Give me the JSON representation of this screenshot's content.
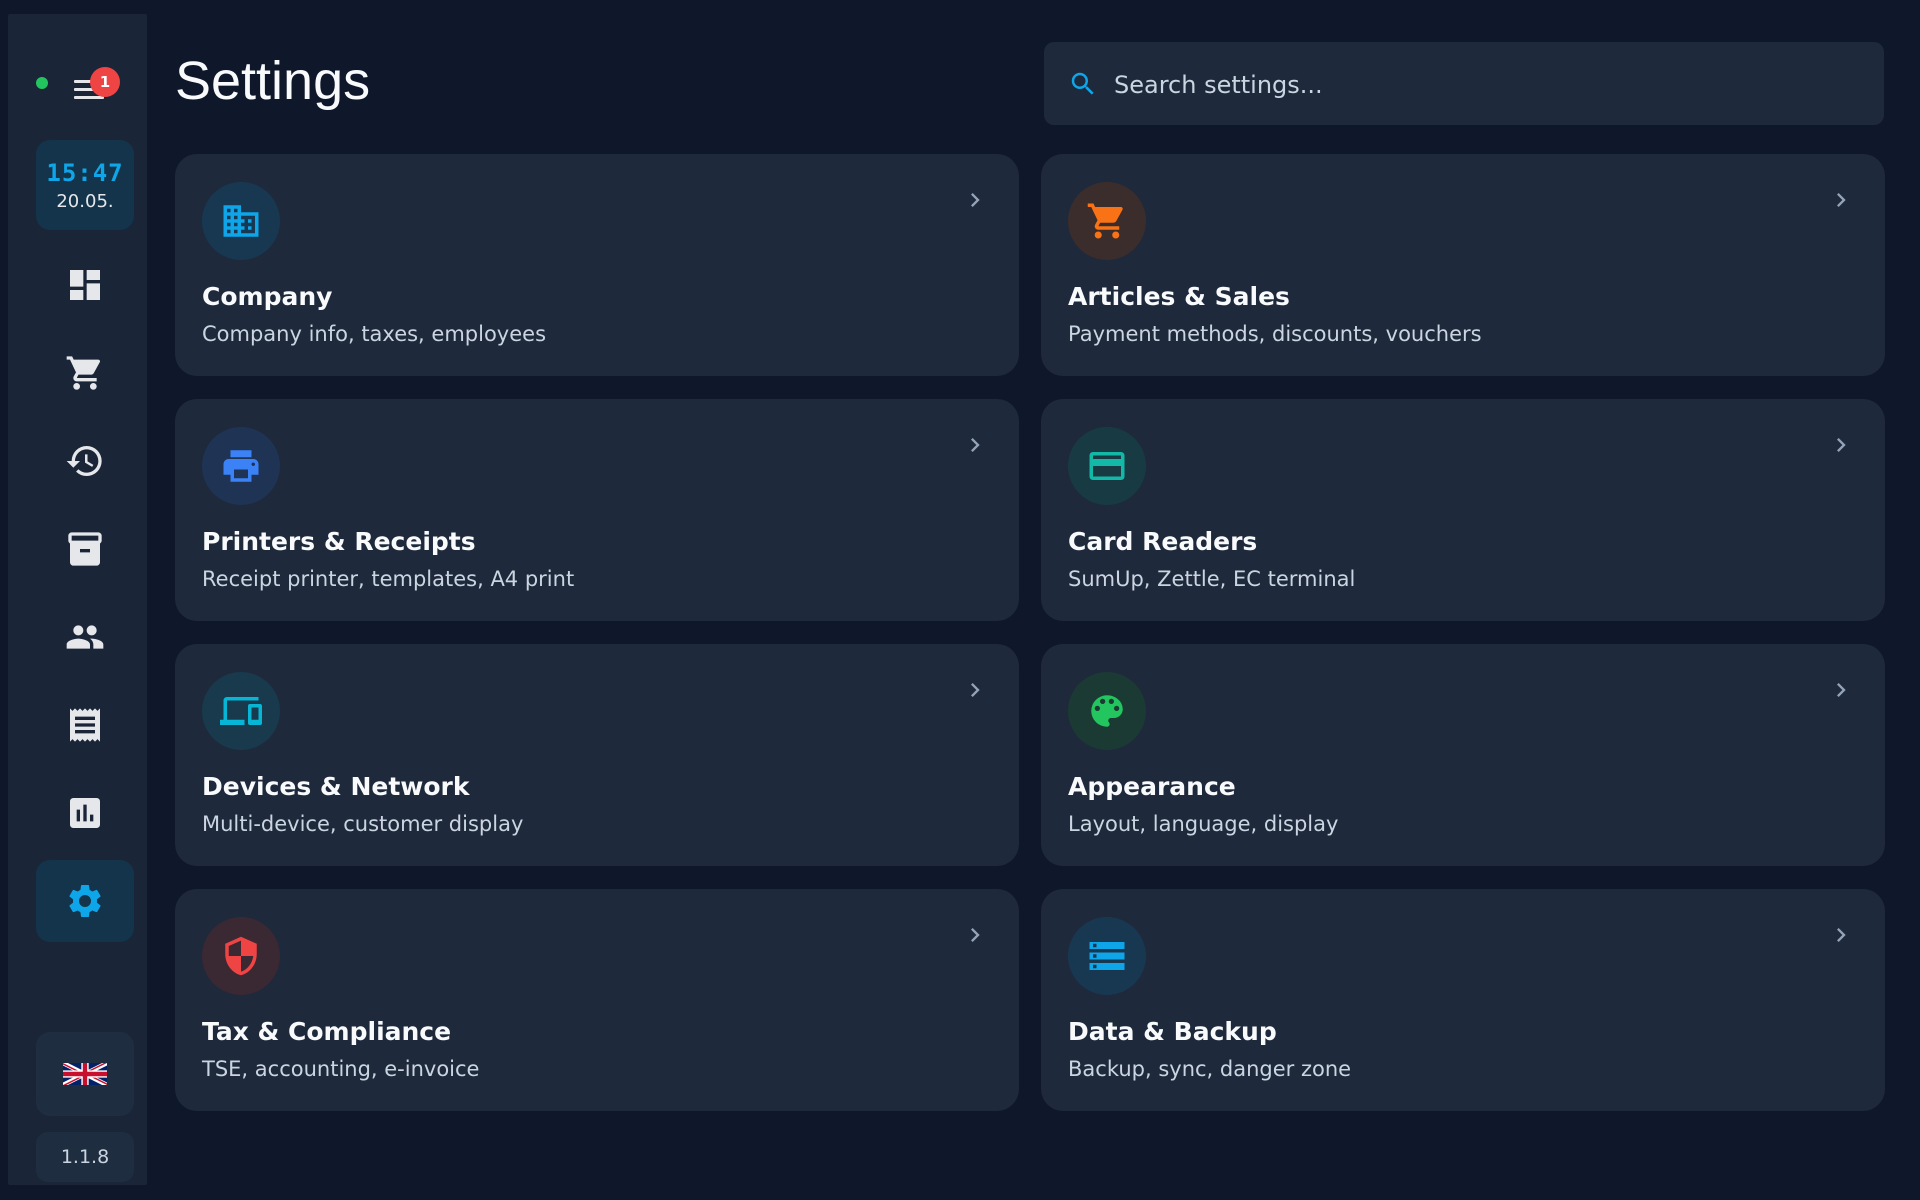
{
  "sidebar": {
    "notification_count": "1",
    "clock": {
      "time": "15:47",
      "date": "20.05."
    },
    "nav": [
      {
        "name": "dashboard"
      },
      {
        "name": "cart"
      },
      {
        "name": "history"
      },
      {
        "name": "archive"
      },
      {
        "name": "customers"
      },
      {
        "name": "receipts"
      },
      {
        "name": "reports"
      },
      {
        "name": "settings",
        "active": true
      }
    ],
    "language": "English (UK flag)",
    "version": "1.1.8"
  },
  "header": {
    "title": "Settings",
    "search_placeholder": "Search settings..."
  },
  "cards": [
    {
      "title": "Company",
      "subtitle": "Company info, taxes, employees",
      "icon": "building-icon",
      "color": "#0ea5e9"
    },
    {
      "title": "Articles & Sales",
      "subtitle": "Payment methods, discounts, vouchers",
      "icon": "cart-icon",
      "color": "#f97316"
    },
    {
      "title": "Printers & Receipts",
      "subtitle": "Receipt printer, templates, A4 print",
      "icon": "printer-icon",
      "color": "#3b82f6"
    },
    {
      "title": "Card Readers",
      "subtitle": "SumUp, Zettle, EC terminal",
      "icon": "credit-card-icon",
      "color": "#14b8a6"
    },
    {
      "title": "Devices & Network",
      "subtitle": "Multi-device, customer display",
      "icon": "devices-icon",
      "color": "#06b6d4"
    },
    {
      "title": "Appearance",
      "subtitle": "Layout, language, display",
      "icon": "palette-icon",
      "color": "#22c55e"
    },
    {
      "title": "Tax & Compliance",
      "subtitle": "TSE, accounting, e-invoice",
      "icon": "shield-icon",
      "color": "#ef4444"
    },
    {
      "title": "Data & Backup",
      "subtitle": "Backup, sync, danger zone",
      "icon": "storage-icon",
      "color": "#0ea5e9"
    }
  ],
  "colors": {
    "background": "#0f172a",
    "sidebar": "#1a2638",
    "card": "#1e293b",
    "accent": "#0ea5e9",
    "badge": "#ef4444",
    "online": "#22c55e"
  }
}
